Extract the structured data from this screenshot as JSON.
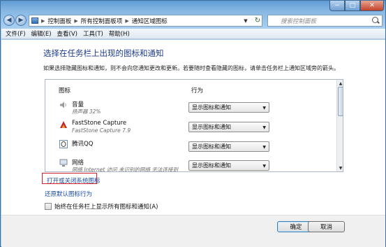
{
  "window": {
    "controls": {
      "minimize": "−",
      "maximize": "□",
      "close": "✕"
    }
  },
  "address_bar": {
    "back_glyph": "◀",
    "forward_glyph": "▶",
    "crumbs": [
      "控制面板",
      "所有控制面板项",
      "通知区域图标"
    ],
    "separator": "▶",
    "dropdown_glyph": "▼",
    "refresh_glyph": "↻"
  },
  "search": {
    "placeholder": "搜索控制面板"
  },
  "menu": {
    "items": [
      "文件(F)",
      "编辑(E)",
      "查看(V)",
      "工具(T)",
      "帮助(H)"
    ]
  },
  "main": {
    "title": "选择在任务栏上出现的图标和通知",
    "description": "如果选择隐藏图标和通知，则不会向您通知更改和更新。若要随时查看隐藏的图标，请单击任务栏上通知区域旁的箭头。",
    "columns": {
      "icon": "图标",
      "behavior": "行为"
    },
    "rows": [
      {
        "name": "音量",
        "sub": "扬声器 32%",
        "behavior": "显示图标和通知",
        "icon": "speaker-icon"
      },
      {
        "name": "FastStone Capture",
        "sub": "FastStone Capture 7.9",
        "behavior": "显示图标和通知",
        "icon": "faststone-icon"
      },
      {
        "name": "腾讯QQ",
        "sub": "",
        "behavior": "显示图标和通知",
        "icon": "qq-icon"
      },
      {
        "name": "网络",
        "sub": "网络 Internet 访问 未识别的网络 无法连接到",
        "behavior": "显示图标和通知",
        "icon": "network-icon"
      }
    ],
    "links": {
      "toggle_system_icons": "打开或关闭系统图标",
      "restore_defaults": "还原默认图标行为"
    },
    "always_show_label": "始终在任务栏上显示所有图标和通知(A)",
    "always_show_checked": false
  },
  "footer": {
    "ok_label": "确定",
    "cancel_label": "取消"
  },
  "colors": {
    "title_blue": "#1e3b8a",
    "link_blue": "#1a4aa8",
    "highlight_red": "#d4202a"
  }
}
